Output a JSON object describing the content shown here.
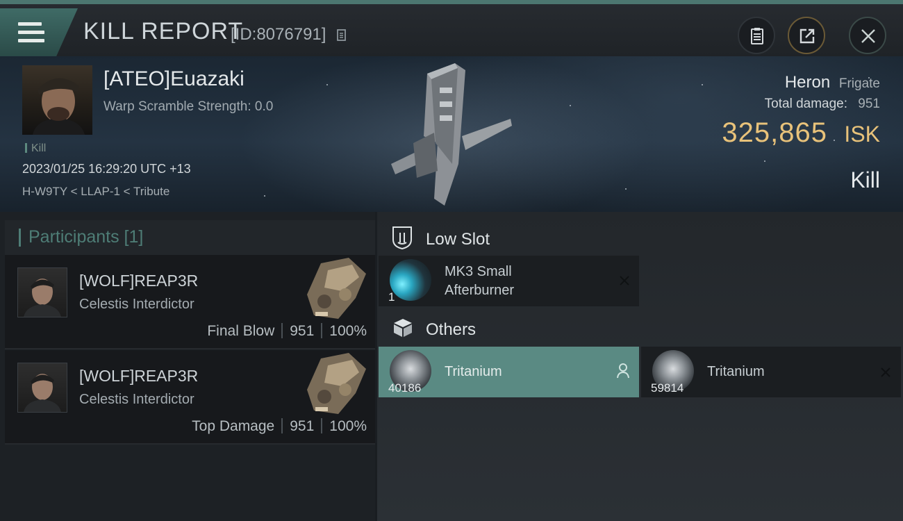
{
  "header": {
    "title": "KILL REPORT",
    "report_id": "[ID:8076791]",
    "icons": [
      "menu-icon",
      "copy-icon",
      "clipboard-icon",
      "share-icon",
      "close-icon"
    ]
  },
  "victim": {
    "name": "[ATEO]Euazaki",
    "warp_scramble": "Warp Scramble Strength: 0.0",
    "kill_tag": "Kill",
    "datetime": "2023/01/25 16:29:20 UTC +13",
    "location": "H-W9TY < LLAP-1 < Tribute",
    "ship_name": "Heron",
    "ship_class": "Frigate",
    "total_damage_label": "Total damage:",
    "total_damage_value": "951",
    "isk_amount": "325,865",
    "isk_unit": "ISK",
    "kill_type": "Kill"
  },
  "participants": {
    "header": "Participants [1]",
    "rows": [
      {
        "name": "[WOLF]REAP3R",
        "ship": "Celestis Interdictor",
        "role": "Final Blow",
        "damage": "951",
        "percent": "100%"
      },
      {
        "name": "[WOLF]REAP3R",
        "ship": "Celestis Interdictor",
        "role": "Top Damage",
        "damage": "951",
        "percent": "100%"
      }
    ]
  },
  "fitting": {
    "low_slot": {
      "title": "Low Slot",
      "items": [
        {
          "name_line1": "MK3 Small",
          "name_line2": "Afterburner",
          "qty": "1"
        }
      ]
    },
    "others": {
      "title": "Others",
      "items": [
        {
          "name": "Tritanium",
          "qty": "40186",
          "status": "dropped"
        },
        {
          "name": "Tritanium",
          "qty": "59814",
          "status": "destroyed"
        }
      ]
    }
  },
  "colors": {
    "accent": "#4e7d76",
    "selected_card": "#5a8a83",
    "isk": "#e8c27a"
  }
}
